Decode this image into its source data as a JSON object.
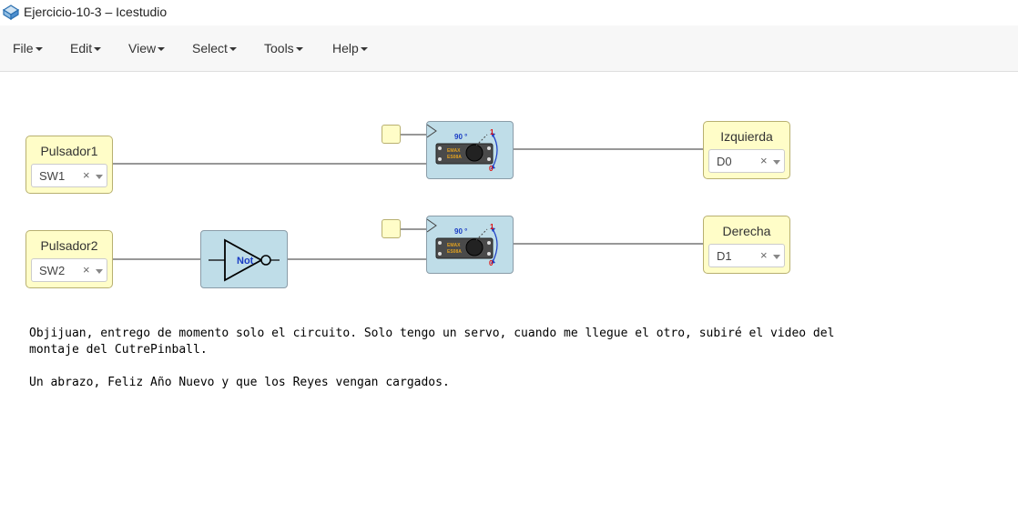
{
  "window": {
    "title": "Ejercicio-10-3 – Icestudio"
  },
  "menu": {
    "items": [
      {
        "label": "File"
      },
      {
        "label": "Edit"
      },
      {
        "label": "View"
      },
      {
        "label": "Select"
      },
      {
        "label": "Tools"
      },
      {
        "label": "Help"
      }
    ]
  },
  "blocks": {
    "pulsador1": {
      "label": "Pulsador1",
      "value": "SW1",
      "clear": "×"
    },
    "pulsador2": {
      "label": "Pulsador2",
      "value": "SW2",
      "clear": "×"
    },
    "izquierda": {
      "label": "Izquierda",
      "value": "D0",
      "clear": "×"
    },
    "derecha": {
      "label": "Derecha",
      "value": "D1",
      "clear": "×"
    },
    "not_gate": {
      "label": "Not"
    },
    "servo1": {
      "angle_label": "90 °",
      "max_label": "1",
      "min_label": "0",
      "chip_line1": "EMAX",
      "chip_line2": "ES08A"
    },
    "servo2": {
      "angle_label": "90 °",
      "max_label": "1",
      "min_label": "0",
      "chip_line1": "EMAX",
      "chip_line2": "ES08A"
    }
  },
  "comment": {
    "line1": "Objijuan, entrego de momento solo el circuito. Solo tengo un servo, cuando me llegue el otro, subiré el video del",
    "line2": "montaje del CutrePinball.",
    "line3": "",
    "line4": "Un abrazo, Feliz Año Nuevo y que los Reyes vengan cargados."
  },
  "colors": {
    "io_block": "#fffdc8",
    "logic_block": "#bfdde8",
    "wire": "#777777",
    "menubar": "#f7f7f7"
  }
}
